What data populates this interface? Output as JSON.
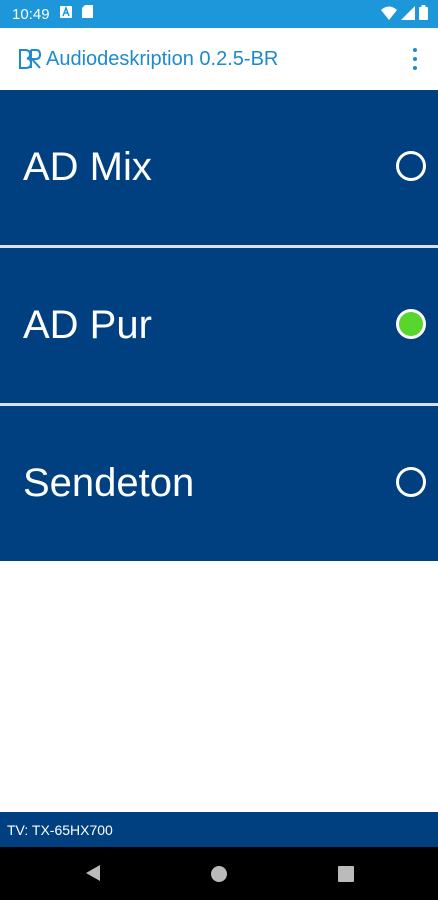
{
  "status_bar": {
    "time": "10:49",
    "icons": [
      "a-notification-icon",
      "sd-card-icon",
      "wifi-icon",
      "signal-icon",
      "battery-icon"
    ],
    "color": "#1d97d9"
  },
  "app_bar": {
    "logo_text": "BR",
    "title": "Audiodeskription 0.2.5-BR",
    "title_color": "#1d8ad0"
  },
  "options": [
    {
      "label": "AD Mix",
      "selected": false
    },
    {
      "label": "AD Pur",
      "selected": true
    },
    {
      "label": "Sendeton",
      "selected": false
    }
  ],
  "colors": {
    "option_bg": "#003f80",
    "selected_radio": "#59d62b"
  },
  "footer": {
    "tv_label": "TV: TX-65HX700"
  },
  "nav": {
    "buttons": [
      "back-icon",
      "home-icon",
      "recents-icon"
    ]
  }
}
